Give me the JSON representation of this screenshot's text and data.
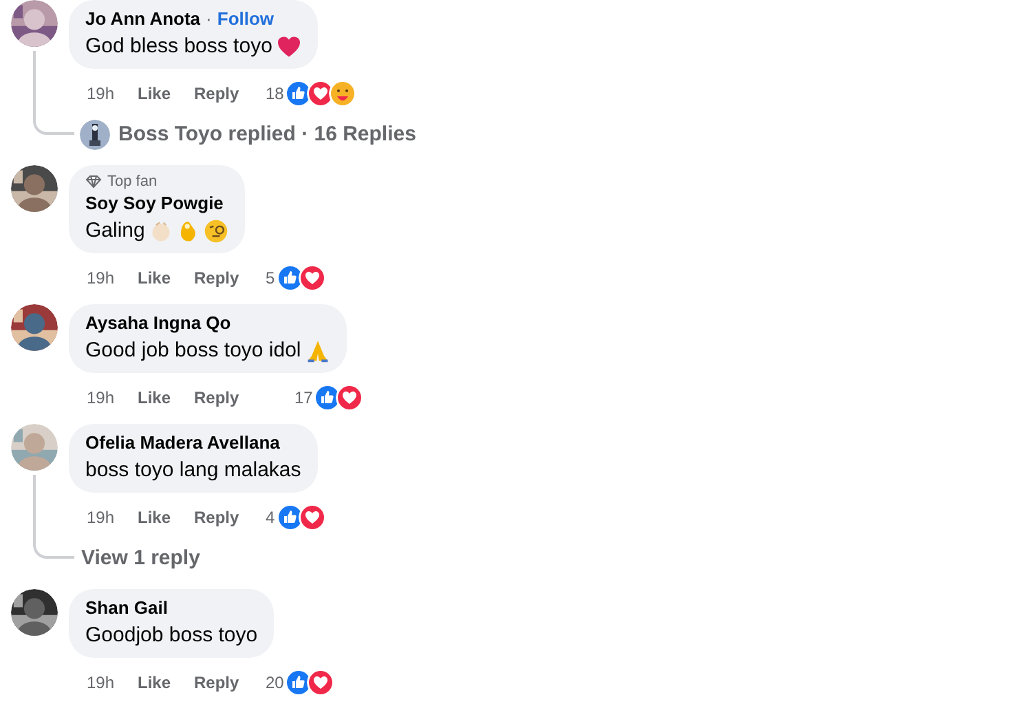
{
  "comments": [
    {
      "name": "Jo Ann Anota",
      "separator": "·",
      "follow": "Follow",
      "text": "God bless boss toyo",
      "emojis": [
        {
          "kind": "heart"
        }
      ],
      "time": "19h",
      "like": "Like",
      "reply": "Reply",
      "reaction_count": "18",
      "reactions": [
        {
          "kind": "like"
        },
        {
          "kind": "love"
        },
        {
          "kind": "care"
        }
      ],
      "thread": {
        "kind": "replied",
        "text": "Boss Toyo replied · 16 Replies"
      }
    },
    {
      "badge": "Top fan",
      "name": "Soy Soy Powgie",
      "text": "Galing",
      "emojis": [
        {
          "kind": "clap"
        },
        {
          "kind": "ok"
        },
        {
          "kind": "monocle"
        }
      ],
      "time": "19h",
      "like": "Like",
      "reply": "Reply",
      "reaction_count": "5",
      "reactions": [
        {
          "kind": "like"
        },
        {
          "kind": "love"
        }
      ]
    },
    {
      "name": "Aysaha Ingna Qo",
      "text": "Good job boss toyo idol",
      "emojis": [
        {
          "kind": "pray"
        }
      ],
      "time": "19h",
      "like": "Like",
      "reply": "Reply",
      "reaction_count": "17",
      "reactions": [
        {
          "kind": "like"
        },
        {
          "kind": "love"
        }
      ]
    },
    {
      "name": "Ofelia Madera Avellana",
      "text": "boss toyo lang malakas",
      "time": "19h",
      "like": "Like",
      "reply": "Reply",
      "reaction_count": "4",
      "reactions": [
        {
          "kind": "like"
        },
        {
          "kind": "love"
        }
      ],
      "thread": {
        "kind": "view",
        "text": "View 1 reply"
      }
    },
    {
      "name": "Shan Gail",
      "text": "Goodjob boss toyo",
      "time": "19h",
      "like": "Like",
      "reply": "Reply",
      "reaction_count": "20",
      "reactions": [
        {
          "kind": "like"
        },
        {
          "kind": "love"
        }
      ]
    }
  ]
}
